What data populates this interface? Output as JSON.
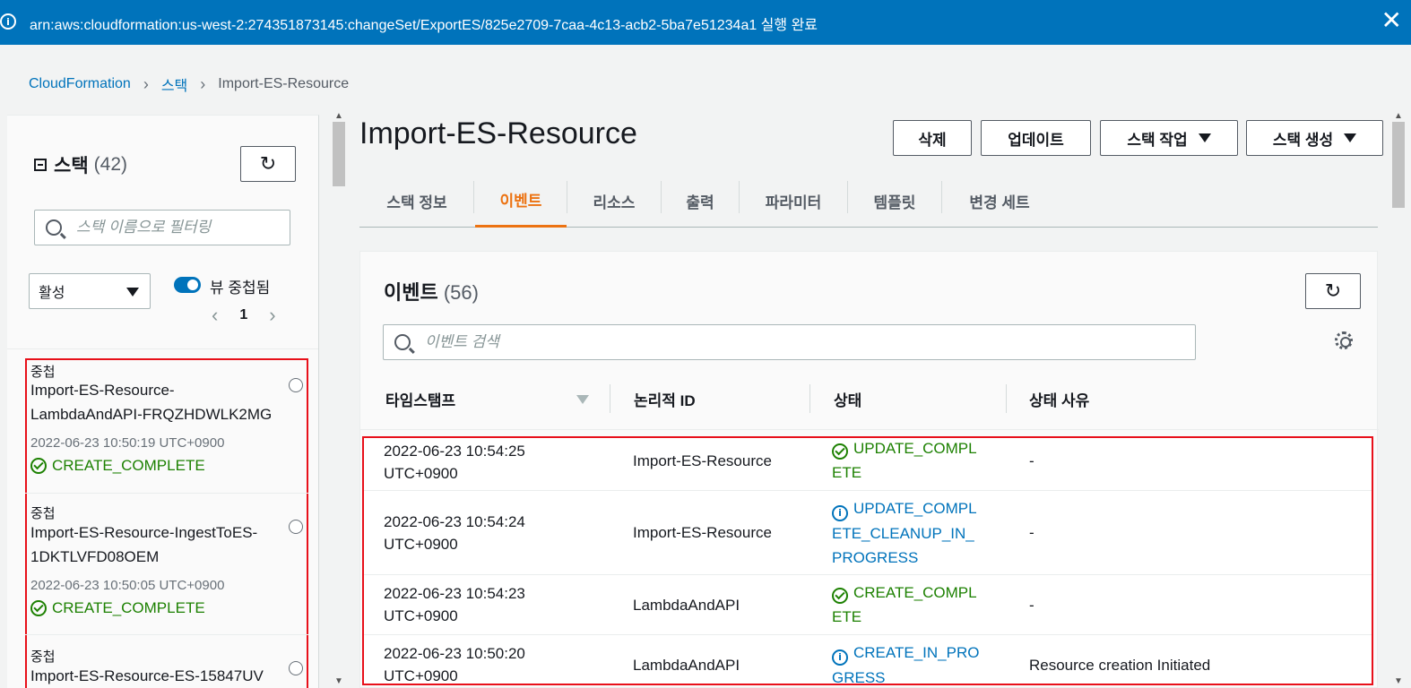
{
  "flash": {
    "message": "arn:aws:cloudformation:us-west-2:274351873145:changeSet/ExportES/825e2709-7caa-4c13-acb2-5ba7e51234a1 실행 완료",
    "close_glyph": "✕"
  },
  "breadcrumb": {
    "items": [
      "CloudFormation",
      "스택",
      "Import-ES-Resource"
    ]
  },
  "sidebar": {
    "title": "스택",
    "count": "(42)",
    "search_placeholder": "스택 이름으로 필터링",
    "filter_select": "활성",
    "toggle_label": "뷰 중첩됨",
    "page": "1",
    "stacks": [
      {
        "tag": "중첩",
        "name": "Import-ES-Resource-LambdaAndAPI-FRQZHDWLK2MG",
        "time": "2022-06-23 10:50:19 UTC+0900",
        "status": "CREATE_COMPLETE"
      },
      {
        "tag": "중첩",
        "name": "Import-ES-Resource-IngestToES-1DKTLVFD08OEM",
        "time": "2022-06-23 10:50:05 UTC+0900",
        "status": "CREATE_COMPLETE"
      },
      {
        "tag": "중첩",
        "name": "Import-ES-Resource-ES-15847UV",
        "time": "",
        "status": ""
      }
    ]
  },
  "main": {
    "title": "Import-ES-Resource",
    "buttons": {
      "delete": "삭제",
      "update": "업데이트",
      "stack_actions": "스택 작업",
      "create_stack": "스택 생성"
    },
    "tabs": [
      "스택 정보",
      "이벤트",
      "리소스",
      "출력",
      "파라미터",
      "템플릿",
      "변경 세트"
    ],
    "active_tab": "이벤트"
  },
  "events": {
    "title": "이벤트",
    "count": "(56)",
    "search_placeholder": "이벤트 검색",
    "columns": [
      "타임스탬프",
      "논리적 ID",
      "상태",
      "상태 사유"
    ],
    "rows": [
      {
        "ts": "2022-06-23 10:54:25 UTC+0900",
        "logical_id": "Import-ES-Resource",
        "status": "UPDATE_COMPLETE",
        "status_kind": "success",
        "reason": "-"
      },
      {
        "ts": "2022-06-23 10:54:24 UTC+0900",
        "logical_id": "Import-ES-Resource",
        "status": "UPDATE_COMPLETE_CLEANUP_IN_PROGRESS",
        "status_kind": "info",
        "reason": "-"
      },
      {
        "ts": "2022-06-23 10:54:23 UTC+0900",
        "logical_id": "LambdaAndAPI",
        "status": "CREATE_COMPLETE",
        "status_kind": "success",
        "reason": "-"
      },
      {
        "ts": "2022-06-23 10:50:20 UTC+0900",
        "logical_id": "LambdaAndAPI",
        "status": "CREATE_IN_PROGRESS",
        "status_kind": "info",
        "reason": "Resource creation Initiated"
      }
    ]
  },
  "icons": {
    "info": "info-icon",
    "success": "check-circle-icon",
    "refresh": "refresh-icon",
    "settings": "gear-icon"
  },
  "colors": {
    "brand_blue": "#0073bb",
    "success_green": "#1d8102",
    "active_tab_orange": "#ec7211",
    "highlight_red": "#e8101a"
  }
}
